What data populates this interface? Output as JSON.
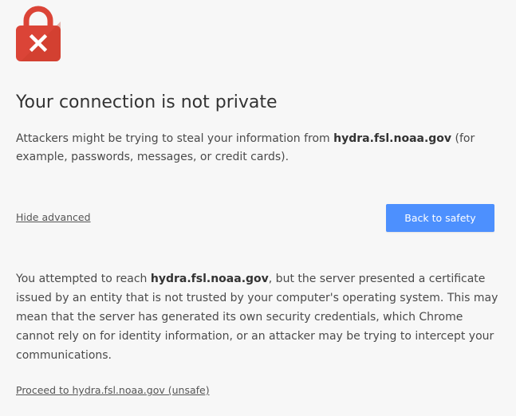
{
  "icon": {
    "name": "lock-error-icon",
    "body_color": "#db4437",
    "mark_color": "#ffffff"
  },
  "page": {
    "title": "Your connection is not private",
    "intro_before": "Attackers might be trying to steal your information from ",
    "domain": "hydra.fsl.noaa.gov",
    "intro_after": " (for example, passwords, messages, or credit cards).",
    "hide_advanced_label": "Hide advanced",
    "back_button_label": "Back to safety",
    "details_before": "You attempted to reach ",
    "details_after": ", but the server presented a certificate issued by an entity that is not trusted by your computer's operating system. This may mean that the server has generated its own security credentials, which Chrome cannot rely on for identity information, or an attacker may be trying to intercept your communications.",
    "proceed_label": "Proceed to hydra.fsl.noaa.gov (unsafe)"
  },
  "colors": {
    "background": "#f7f7f7",
    "button": "#4d90fe",
    "error_red": "#db4437"
  }
}
